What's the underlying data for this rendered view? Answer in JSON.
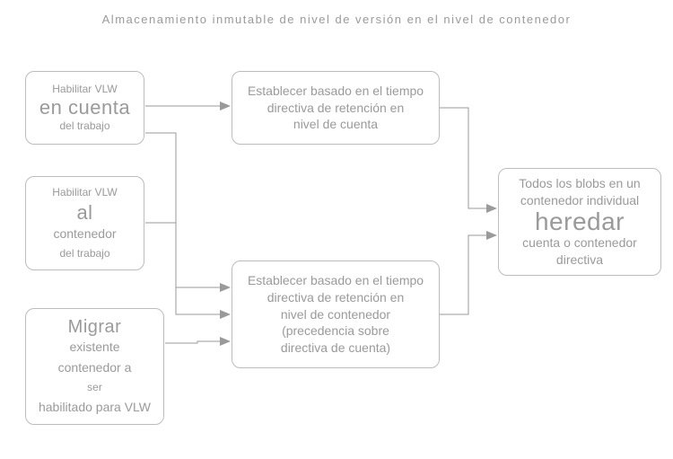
{
  "title": "Almacenamiento inmutable de nivel de versión en el nivel de contenedor",
  "boxA": {
    "l1": "Habilitar VLW",
    "l2": "en cuenta",
    "l3": "del trabajo"
  },
  "boxB": {
    "l1": "Habilitar VLW",
    "l2": "al",
    "l3": "contenedor",
    "l4": "del trabajo"
  },
  "boxC": {
    "l1": "Migrar",
    "l2": "existente",
    "l3": "contenedor a",
    "l4": "ser",
    "l5": "habilitado para VLW"
  },
  "boxD": {
    "l1": "Establecer basado en el tiempo",
    "l2": "directiva de retención en",
    "l3": "nivel de cuenta"
  },
  "boxE": {
    "l1": "Establecer basado en el tiempo",
    "l2": "directiva de retención en",
    "l3": "nivel de contenedor",
    "l4": "(precedencia sobre",
    "l5": "directiva de cuenta)"
  },
  "boxF": {
    "l1": "Todos los blobs en un",
    "l2": "contenedor individual",
    "l3": "heredar",
    "l4": "cuenta o contenedor",
    "l5": "directiva"
  }
}
